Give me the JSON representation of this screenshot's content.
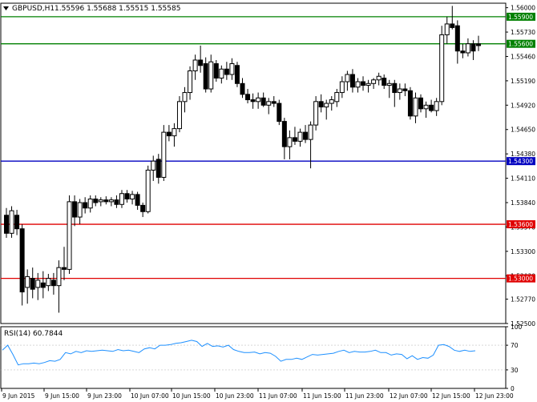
{
  "header": {
    "symbol": "GBPUSD,H1",
    "ohlc": "1.55596 1.55688 1.55515 1.55585",
    "menu_icon": "triangle-down-icon"
  },
  "indicator": {
    "label": "RSI(14) 60.7844",
    "levels": [
      "100",
      "70",
      "30",
      "0"
    ]
  },
  "colors": {
    "background": "#ffffff",
    "candle": "#000000",
    "resistance": "#008000",
    "support_mid": "#0000c0",
    "support_low": "#e00000",
    "rsi_line": "#1e90ff",
    "badge_text": "#ffffff"
  },
  "chart_data": {
    "type": "candlestick",
    "symbol": "GBPUSD",
    "timeframe": "H1",
    "ylim": [
      1.525,
      1.5605
    ],
    "y_ticks": [
      "1.56000",
      "1.55730",
      "1.55460",
      "1.55190",
      "1.54920",
      "1.54650",
      "1.54380",
      "1.54110",
      "1.53840",
      "1.53570",
      "1.53300",
      "1.53030",
      "1.52770",
      "1.52500"
    ],
    "x_ticks": [
      "9 Jun 2015",
      "9 Jun 15:00",
      "9 Jun 23:00",
      "10 Jun 07:00",
      "10 Jun 15:00",
      "10 Jun 23:00",
      "11 Jun 07:00",
      "11 Jun 15:00",
      "11 Jun 23:00",
      "12 Jun 07:00",
      "12 Jun 15:00",
      "12 Jun 23:00"
    ],
    "levels": [
      {
        "price": 1.559,
        "label": "1.55900",
        "kind": "resistance"
      },
      {
        "price": 1.556,
        "label": "1.55600",
        "kind": "resistance"
      },
      {
        "price": 1.543,
        "label": "1.54300",
        "kind": "support_mid"
      },
      {
        "price": 1.536,
        "label": "1.53600",
        "kind": "support_low"
      },
      {
        "price": 1.53,
        "label": "1.53000",
        "kind": "support_low"
      }
    ],
    "candles": [
      {
        "o": 1.537,
        "h": 1.5378,
        "l": 1.5345,
        "c": 1.535
      },
      {
        "o": 1.535,
        "h": 1.538,
        "l": 1.5345,
        "c": 1.5375
      },
      {
        "o": 1.537,
        "h": 1.5376,
        "l": 1.5348,
        "c": 1.5355
      },
      {
        "o": 1.5355,
        "h": 1.536,
        "l": 1.527,
        "c": 1.5285
      },
      {
        "o": 1.529,
        "h": 1.531,
        "l": 1.5272,
        "c": 1.5302
      },
      {
        "o": 1.53,
        "h": 1.5312,
        "l": 1.5278,
        "c": 1.5288
      },
      {
        "o": 1.529,
        "h": 1.5306,
        "l": 1.5276,
        "c": 1.5298
      },
      {
        "o": 1.5295,
        "h": 1.5308,
        "l": 1.5278,
        "c": 1.529
      },
      {
        "o": 1.5292,
        "h": 1.5305,
        "l": 1.5286,
        "c": 1.53
      },
      {
        "o": 1.5298,
        "h": 1.5306,
        "l": 1.5282,
        "c": 1.5292
      },
      {
        "o": 1.5292,
        "h": 1.532,
        "l": 1.5262,
        "c": 1.5312
      },
      {
        "o": 1.5312,
        "h": 1.5335,
        "l": 1.5298,
        "c": 1.531
      },
      {
        "o": 1.531,
        "h": 1.5392,
        "l": 1.5305,
        "c": 1.5385
      },
      {
        "o": 1.5385,
        "h": 1.5392,
        "l": 1.5358,
        "c": 1.5368
      },
      {
        "o": 1.5368,
        "h": 1.5388,
        "l": 1.536,
        "c": 1.5384
      },
      {
        "o": 1.5384,
        "h": 1.539,
        "l": 1.5372,
        "c": 1.5378
      },
      {
        "o": 1.5378,
        "h": 1.5392,
        "l": 1.5373,
        "c": 1.5388
      },
      {
        "o": 1.5388,
        "h": 1.5392,
        "l": 1.538,
        "c": 1.5384
      },
      {
        "o": 1.5385,
        "h": 1.539,
        "l": 1.538,
        "c": 1.5387
      },
      {
        "o": 1.5387,
        "h": 1.5391,
        "l": 1.5382,
        "c": 1.5385
      },
      {
        "o": 1.5385,
        "h": 1.539,
        "l": 1.538,
        "c": 1.5387
      },
      {
        "o": 1.5387,
        "h": 1.5392,
        "l": 1.5378,
        "c": 1.5382
      },
      {
        "o": 1.5382,
        "h": 1.5398,
        "l": 1.5378,
        "c": 1.5394
      },
      {
        "o": 1.5394,
        "h": 1.5398,
        "l": 1.5384,
        "c": 1.5388
      },
      {
        "o": 1.5388,
        "h": 1.5397,
        "l": 1.5382,
        "c": 1.5393
      },
      {
        "o": 1.5393,
        "h": 1.5396,
        "l": 1.5376,
        "c": 1.5381
      },
      {
        "o": 1.5381,
        "h": 1.5384,
        "l": 1.5368,
        "c": 1.5374
      },
      {
        "o": 1.5374,
        "h": 1.5425,
        "l": 1.5372,
        "c": 1.542
      },
      {
        "o": 1.542,
        "h": 1.5436,
        "l": 1.5408,
        "c": 1.543
      },
      {
        "o": 1.5432,
        "h": 1.5438,
        "l": 1.5405,
        "c": 1.5412
      },
      {
        "o": 1.5412,
        "h": 1.547,
        "l": 1.5408,
        "c": 1.5462
      },
      {
        "o": 1.5462,
        "h": 1.547,
        "l": 1.5452,
        "c": 1.5458
      },
      {
        "o": 1.5458,
        "h": 1.5472,
        "l": 1.5446,
        "c": 1.5466
      },
      {
        "o": 1.5466,
        "h": 1.5502,
        "l": 1.5462,
        "c": 1.5496
      },
      {
        "o": 1.5496,
        "h": 1.5512,
        "l": 1.5484,
        "c": 1.5506
      },
      {
        "o": 1.5506,
        "h": 1.5535,
        "l": 1.5498,
        "c": 1.553
      },
      {
        "o": 1.553,
        "h": 1.5548,
        "l": 1.552,
        "c": 1.5542
      },
      {
        "o": 1.5542,
        "h": 1.5558,
        "l": 1.5528,
        "c": 1.5536
      },
      {
        "o": 1.5538,
        "h": 1.5545,
        "l": 1.5506,
        "c": 1.551
      },
      {
        "o": 1.551,
        "h": 1.5548,
        "l": 1.5506,
        "c": 1.554
      },
      {
        "o": 1.5538,
        "h": 1.5542,
        "l": 1.5518,
        "c": 1.5522
      },
      {
        "o": 1.5522,
        "h": 1.5536,
        "l": 1.5516,
        "c": 1.5532
      },
      {
        "o": 1.5532,
        "h": 1.554,
        "l": 1.552,
        "c": 1.5526
      },
      {
        "o": 1.5526,
        "h": 1.5544,
        "l": 1.552,
        "c": 1.5538
      },
      {
        "o": 1.5536,
        "h": 1.554,
        "l": 1.5512,
        "c": 1.5516
      },
      {
        "o": 1.5516,
        "h": 1.5522,
        "l": 1.55,
        "c": 1.5504
      },
      {
        "o": 1.5504,
        "h": 1.551,
        "l": 1.5494,
        "c": 1.5498
      },
      {
        "o": 1.5498,
        "h": 1.5505,
        "l": 1.5488,
        "c": 1.5496
      },
      {
        "o": 1.5496,
        "h": 1.5506,
        "l": 1.5488,
        "c": 1.55
      },
      {
        "o": 1.55,
        "h": 1.5506,
        "l": 1.549,
        "c": 1.5492
      },
      {
        "o": 1.5492,
        "h": 1.55,
        "l": 1.5482,
        "c": 1.5496
      },
      {
        "o": 1.5496,
        "h": 1.5502,
        "l": 1.549,
        "c": 1.5494
      },
      {
        "o": 1.5494,
        "h": 1.5498,
        "l": 1.547,
        "c": 1.5474
      },
      {
        "o": 1.5474,
        "h": 1.5478,
        "l": 1.5432,
        "c": 1.5446
      },
      {
        "o": 1.5446,
        "h": 1.5464,
        "l": 1.5432,
        "c": 1.5456
      },
      {
        "o": 1.5456,
        "h": 1.5468,
        "l": 1.5448,
        "c": 1.5452
      },
      {
        "o": 1.5452,
        "h": 1.5466,
        "l": 1.5446,
        "c": 1.5462
      },
      {
        "o": 1.5462,
        "h": 1.547,
        "l": 1.545,
        "c": 1.5454
      },
      {
        "o": 1.5454,
        "h": 1.5474,
        "l": 1.5422,
        "c": 1.547
      },
      {
        "o": 1.547,
        "h": 1.5502,
        "l": 1.5464,
        "c": 1.5496
      },
      {
        "o": 1.5496,
        "h": 1.5504,
        "l": 1.5484,
        "c": 1.549
      },
      {
        "o": 1.549,
        "h": 1.5498,
        "l": 1.5476,
        "c": 1.5494
      },
      {
        "o": 1.5494,
        "h": 1.5502,
        "l": 1.5486,
        "c": 1.5498
      },
      {
        "o": 1.5496,
        "h": 1.551,
        "l": 1.549,
        "c": 1.5506
      },
      {
        "o": 1.5506,
        "h": 1.5524,
        "l": 1.55,
        "c": 1.5518
      },
      {
        "o": 1.5518,
        "h": 1.553,
        "l": 1.5508,
        "c": 1.5526
      },
      {
        "o": 1.5526,
        "h": 1.5532,
        "l": 1.5506,
        "c": 1.5512
      },
      {
        "o": 1.5512,
        "h": 1.5522,
        "l": 1.5506,
        "c": 1.5518
      },
      {
        "o": 1.5518,
        "h": 1.5524,
        "l": 1.5508,
        "c": 1.5514
      },
      {
        "o": 1.5514,
        "h": 1.552,
        "l": 1.5506,
        "c": 1.5516
      },
      {
        "o": 1.5516,
        "h": 1.5522,
        "l": 1.551,
        "c": 1.552
      },
      {
        "o": 1.552,
        "h": 1.5528,
        "l": 1.5514,
        "c": 1.5524
      },
      {
        "o": 1.5522,
        "h": 1.5526,
        "l": 1.551,
        "c": 1.5514
      },
      {
        "o": 1.5514,
        "h": 1.552,
        "l": 1.55,
        "c": 1.5516
      },
      {
        "o": 1.5516,
        "h": 1.552,
        "l": 1.549,
        "c": 1.5506
      },
      {
        "o": 1.5506,
        "h": 1.5516,
        "l": 1.5498,
        "c": 1.551
      },
      {
        "o": 1.551,
        "h": 1.5516,
        "l": 1.5502,
        "c": 1.5508
      },
      {
        "o": 1.5508,
        "h": 1.5512,
        "l": 1.5476,
        "c": 1.548
      },
      {
        "o": 1.548,
        "h": 1.5506,
        "l": 1.5472,
        "c": 1.55
      },
      {
        "o": 1.55,
        "h": 1.5504,
        "l": 1.5484,
        "c": 1.5488
      },
      {
        "o": 1.5488,
        "h": 1.5496,
        "l": 1.5478,
        "c": 1.5492
      },
      {
        "o": 1.5492,
        "h": 1.5498,
        "l": 1.5484,
        "c": 1.5486
      },
      {
        "o": 1.5486,
        "h": 1.55,
        "l": 1.548,
        "c": 1.5496
      },
      {
        "o": 1.5496,
        "h": 1.558,
        "l": 1.5492,
        "c": 1.557
      },
      {
        "o": 1.557,
        "h": 1.559,
        "l": 1.556,
        "c": 1.5582
      },
      {
        "o": 1.5582,
        "h": 1.5602,
        "l": 1.5576,
        "c": 1.5578
      },
      {
        "o": 1.558,
        "h": 1.5586,
        "l": 1.5538,
        "c": 1.5552
      },
      {
        "o": 1.5552,
        "h": 1.556,
        "l": 1.5544,
        "c": 1.555
      },
      {
        "o": 1.555,
        "h": 1.5566,
        "l": 1.5546,
        "c": 1.556
      },
      {
        "o": 1.556,
        "h": 1.5564,
        "l": 1.5542,
        "c": 1.5552
      },
      {
        "o": 1.556,
        "h": 1.5569,
        "l": 1.5552,
        "c": 1.5558
      }
    ],
    "rsi": {
      "name": "RSI(14)",
      "last": 60.7844,
      "ylim": [
        0,
        100
      ],
      "levels": [
        70,
        30
      ],
      "values": [
        62,
        70,
        55,
        38,
        40,
        40,
        41,
        40,
        42,
        45,
        44,
        47,
        58,
        56,
        60,
        58,
        61,
        60,
        61,
        62,
        61,
        60,
        63,
        61,
        62,
        60,
        58,
        64,
        66,
        64,
        70,
        70,
        71,
        73,
        74,
        76,
        78,
        76,
        68,
        73,
        68,
        69,
        67,
        70,
        63,
        60,
        58,
        58,
        59,
        56,
        58,
        57,
        52,
        44,
        47,
        47,
        49,
        47,
        51,
        55,
        54,
        55,
        56,
        57,
        60,
        62,
        58,
        60,
        59,
        59,
        60,
        62,
        58,
        58,
        54,
        56,
        55,
        48,
        53,
        47,
        50,
        49,
        54,
        70,
        71,
        68,
        62,
        60,
        62,
        60,
        61
      ]
    }
  }
}
